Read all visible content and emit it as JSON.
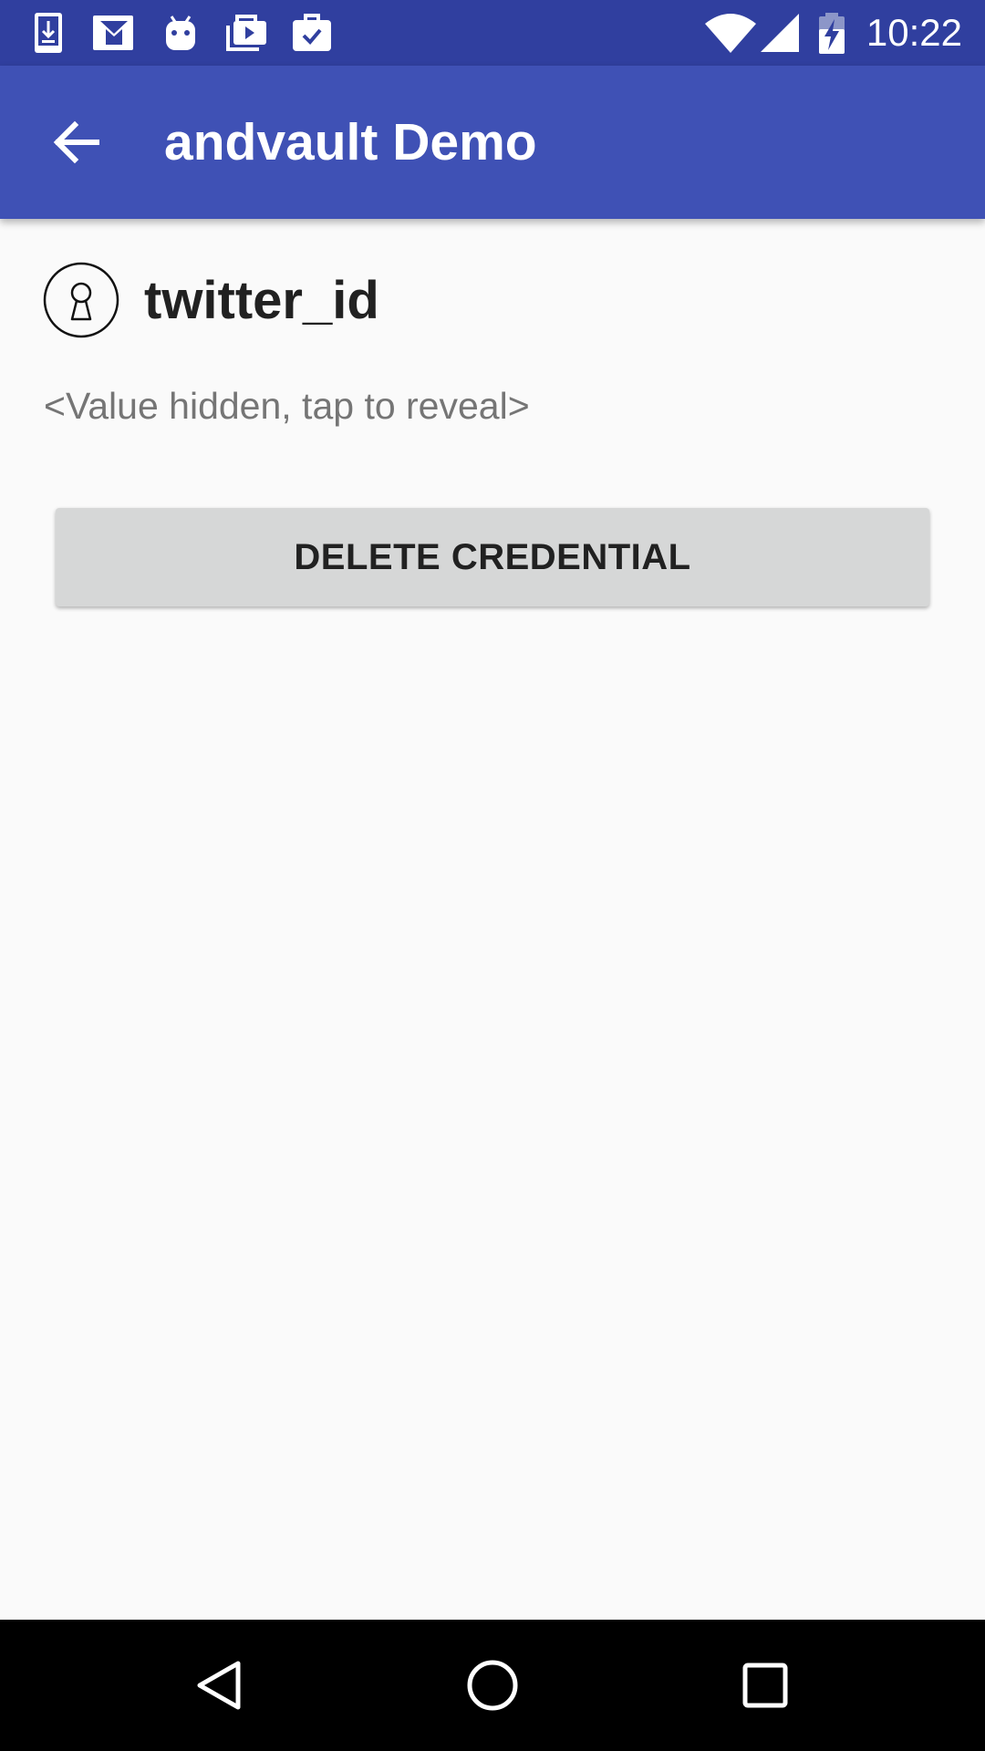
{
  "status_bar": {
    "time": "10:22",
    "notification_icons": [
      "download-icon",
      "gmail-icon",
      "android-icon",
      "play-store-icon",
      "work-briefcase-icon"
    ],
    "system_icons": [
      "wifi-icon",
      "signal-icon",
      "battery-charging-icon"
    ]
  },
  "app_bar": {
    "title": "andvault Demo",
    "nav_icon": "back-arrow-icon"
  },
  "credential": {
    "name": "twitter_id",
    "icon": "keyhole-icon",
    "value_placeholder": "<Value hidden, tap to reveal>"
  },
  "actions": {
    "delete_label": "DELETE CREDENTIAL"
  },
  "nav_bar": {
    "buttons": [
      "back-icon",
      "home-icon",
      "recents-icon"
    ]
  },
  "colors": {
    "status_bar": "#303f9f",
    "app_bar": "#3f51b5",
    "background": "#fafafa",
    "button": "#d6d7d7"
  }
}
